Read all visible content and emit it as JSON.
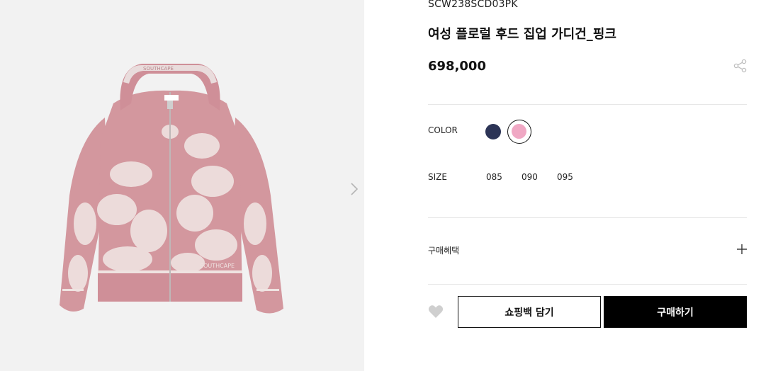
{
  "product": {
    "sku": "SCW238SCD03PK",
    "name": "여성 플로럴 후드 집업 가디건_핑크",
    "price": "698,000",
    "image_brand_text": "SOUTHCAPE"
  },
  "options": {
    "color_label": "COLOR",
    "colors": [
      {
        "name": "navy",
        "hex": "#2c3456",
        "selected": false
      },
      {
        "name": "pink",
        "hex": "#f0a8c4",
        "selected": true
      }
    ],
    "size_label": "SIZE",
    "sizes": [
      "085",
      "090",
      "095"
    ]
  },
  "benefits": {
    "label": "구매혜택"
  },
  "actions": {
    "add_to_bag_label": "쇼핑백 담기",
    "buy_label": "구매하기"
  },
  "icons": {
    "share": "share-icon",
    "wishlist": "heart-icon",
    "expand": "plus-icon",
    "next": "chevron-right-icon"
  },
  "colors": {
    "garment_pink": "#d3979e",
    "floral": "#efe3e1",
    "gallery_bg": "#f2f2f2",
    "buy_button": "#000000"
  }
}
